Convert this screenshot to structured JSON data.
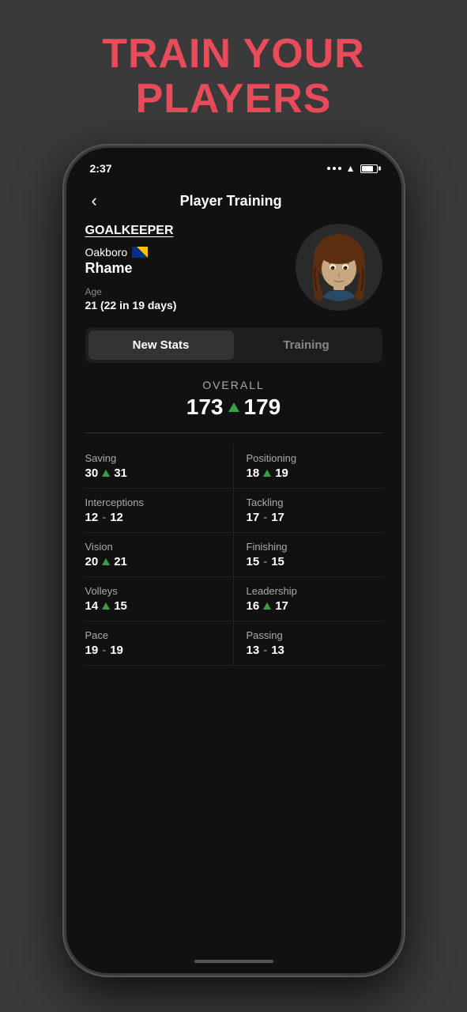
{
  "header": {
    "line1": "TRAIN YOUR",
    "line2": "PLAYERS"
  },
  "statusBar": {
    "time": "2:37",
    "batteryLevel": "80"
  },
  "navBar": {
    "backLabel": "‹",
    "title": "Player Training"
  },
  "player": {
    "position": "GOALKEEPER",
    "teamName": "Oakboro",
    "playerName": "Rhame",
    "ageLabel": "Age",
    "ageValue": "21 (22 in 19 days)"
  },
  "tabs": {
    "tab1": "New Stats",
    "tab2": "Training"
  },
  "overall": {
    "label": "OVERALL",
    "oldValue": "173",
    "newValue": "179"
  },
  "stats": [
    {
      "name": "Saving",
      "old": "30",
      "new": "31",
      "changed": true,
      "side": "left"
    },
    {
      "name": "Positioning",
      "old": "18",
      "new": "19",
      "changed": true,
      "side": "right"
    },
    {
      "name": "Interceptions",
      "old": "12",
      "new": "12",
      "changed": false,
      "side": "left"
    },
    {
      "name": "Tackling",
      "old": "17",
      "new": "17",
      "changed": false,
      "side": "right"
    },
    {
      "name": "Vision",
      "old": "20",
      "new": "21",
      "changed": true,
      "side": "left"
    },
    {
      "name": "Finishing",
      "old": "15",
      "new": "15",
      "changed": false,
      "side": "right"
    },
    {
      "name": "Volleys",
      "old": "14",
      "new": "15",
      "changed": true,
      "side": "left"
    },
    {
      "name": "Leadership",
      "old": "16",
      "new": "17",
      "changed": true,
      "side": "right"
    },
    {
      "name": "Pace",
      "old": "19",
      "new": "19",
      "changed": false,
      "side": "left"
    },
    {
      "name": "Passing",
      "old": "13",
      "new": "13",
      "changed": false,
      "side": "right"
    }
  ]
}
